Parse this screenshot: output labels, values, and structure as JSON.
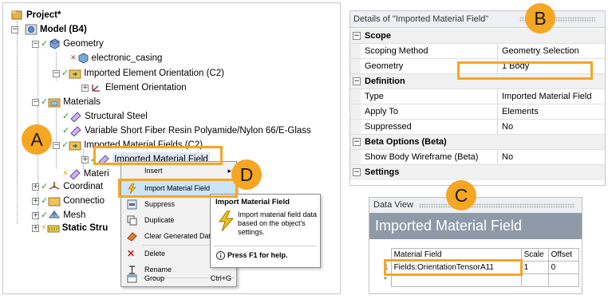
{
  "tree": {
    "items": [
      {
        "label": "Project*"
      },
      {
        "label": "Model (B4)"
      },
      {
        "label": "Geometry"
      },
      {
        "label": "electronic_casing"
      },
      {
        "label": "Imported Element Orientation (C2)"
      },
      {
        "label": "Element Orientation"
      },
      {
        "label": "Materials"
      },
      {
        "label": "Structural Steel"
      },
      {
        "label": "Variable Short Fiber Resin Polyamide/Nylon 66/E-Glass"
      },
      {
        "label": "Imported Material Fields (C2)"
      },
      {
        "label": "Imported Material Field"
      },
      {
        "label": "Materi"
      },
      {
        "label": "Coordinat"
      },
      {
        "label": "Connectio"
      },
      {
        "label": "Mesh"
      },
      {
        "label": "Static Stru"
      }
    ]
  },
  "context_menu": {
    "items": [
      {
        "label": "Insert",
        "has_submenu": true
      },
      {
        "label": "Import Material Field"
      },
      {
        "label": "Suppress"
      },
      {
        "label": "Duplicate"
      },
      {
        "label": "Clear Generated Data"
      },
      {
        "label": "Delete"
      },
      {
        "label": "Rename"
      },
      {
        "label": "Group",
        "shortcut": "Ctrl+G"
      }
    ]
  },
  "tooltip": {
    "title": "Import Material Field",
    "body": "Import material field data based on the object's settings.",
    "help": "Press F1 for help."
  },
  "details": {
    "title": "Details of \"Imported Material Field\"",
    "sections": [
      {
        "name": "Scope",
        "rows": [
          {
            "key": "Scoping Method",
            "value": "Geometry Selection"
          },
          {
            "key": "Geometry",
            "value": "1 Body"
          }
        ]
      },
      {
        "name": "Definition",
        "rows": [
          {
            "key": "Type",
            "value": "Imported Material Field"
          },
          {
            "key": "Apply To",
            "value": "Elements"
          },
          {
            "key": "Suppressed",
            "value": "No"
          }
        ]
      },
      {
        "name": "Beta Options (Beta)",
        "rows": [
          {
            "key": "Show Body Wireframe (Beta)",
            "value": "No"
          }
        ]
      },
      {
        "name": "Settings",
        "rows": []
      }
    ]
  },
  "data_view": {
    "title": "Data View",
    "header": "Imported Material Field",
    "columns": [
      "Material Field",
      "Scale",
      "Offset"
    ],
    "rows": [
      {
        "index": "1",
        "field": "Fields:OrientationTensorA11",
        "scale": "1",
        "offset": "0"
      },
      {
        "index": "*",
        "field": "",
        "scale": "",
        "offset": ""
      }
    ]
  },
  "callouts": {
    "a": "A",
    "b": "B",
    "c": "C",
    "d": "D"
  },
  "colors": {
    "accent": "#f5a623",
    "check": "#2a9d2a",
    "header_bar": "#8f9aa8"
  }
}
